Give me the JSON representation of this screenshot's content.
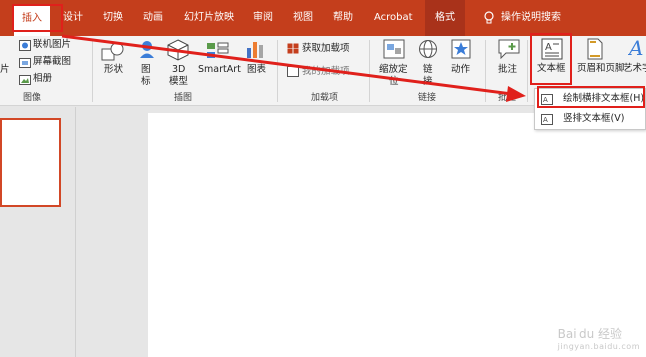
{
  "tabs": [
    "插入",
    "设计",
    "切换",
    "动画",
    "幻灯片放映",
    "审阅",
    "视图",
    "帮助",
    "Acrobat",
    "格式"
  ],
  "tell_me": "操作说明搜索",
  "ribbon": {
    "image_group": {
      "online_pictures": "联机图片",
      "screenshot": "屏幕截图",
      "album": "相册",
      "pictures_partial": "片",
      "label": "图像"
    },
    "illustrations": {
      "shapes": "形状",
      "icons_top": "图",
      "icons_bottom": "标",
      "model_top": "3D",
      "model_bottom": "模型",
      "smartart": "SmartArt",
      "chart": "图表",
      "label": "插图"
    },
    "addins": {
      "get": "获取加载项",
      "my": "我的加载项",
      "label": "加载项"
    },
    "links": {
      "zoom_top": "缩放定",
      "zoom_bottom": "位",
      "link_top": "链",
      "link_bottom": "接",
      "action": "动作",
      "label": "链接"
    },
    "comments": {
      "comment": "批注",
      "label": "批注"
    },
    "text": {
      "textbox": "文本框",
      "header_footer": "页眉和页脚",
      "wordart": "艺术字"
    }
  },
  "dropdown": {
    "horizontal": "绘制横排文本框(H)",
    "vertical": "竖排文本框(V)"
  },
  "watermark": {
    "brand": "Bai du 经验",
    "url": "jingyan.baidu.com"
  },
  "colors": {
    "accent": "#c43e1c",
    "highlight": "#e0201b"
  }
}
